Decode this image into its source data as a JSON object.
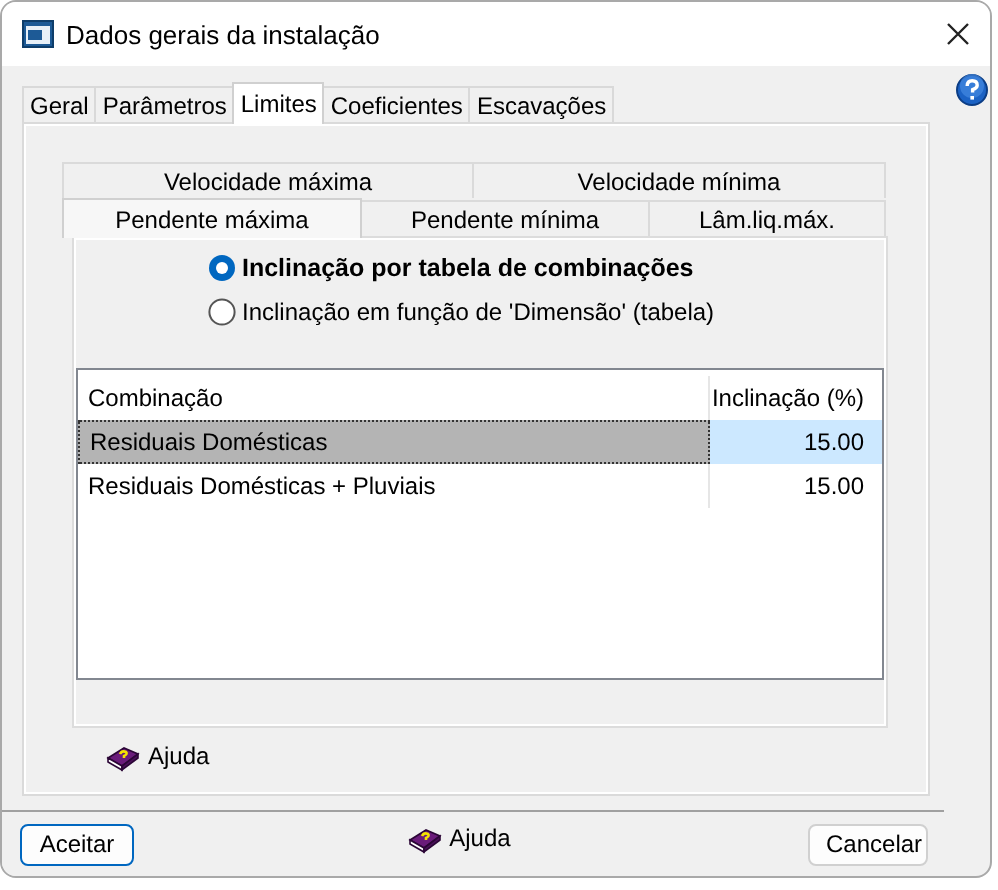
{
  "window": {
    "title": "Dados gerais da instalação"
  },
  "tabs": [
    {
      "label": "Geral",
      "selected": false
    },
    {
      "label": "Parâmetros",
      "selected": false
    },
    {
      "label": "Limites",
      "selected": true
    },
    {
      "label": "Coeficientes",
      "selected": false
    },
    {
      "label": "Escavações",
      "selected": false
    }
  ],
  "subtab_rows": [
    {
      "tabs": [
        {
          "label": "Velocidade máxima",
          "selected": false
        },
        {
          "label": "Velocidade mínima",
          "selected": false
        }
      ]
    },
    {
      "tabs": [
        {
          "label": "Pendente máxima",
          "selected": true
        },
        {
          "label": "Pendente mínima",
          "selected": false
        },
        {
          "label": "Lâm.liq.máx.",
          "selected": false
        }
      ]
    }
  ],
  "options": [
    {
      "label": "Inclinação por tabela de combinações",
      "selected": true
    },
    {
      "label": "Inclinação em função de 'Dimensão' (tabela)",
      "selected": false
    }
  ],
  "table": {
    "columns": [
      "Combinação",
      "Inclinação (%)"
    ],
    "rows": [
      {
        "cells": [
          "Residuais Domésticas",
          "15.00"
        ],
        "selected": true
      },
      {
        "cells": [
          "Residuais Domésticas + Pluviais",
          "15.00"
        ],
        "selected": false
      }
    ]
  },
  "help_link": "Ajuda",
  "footer": {
    "accept": "Aceitar",
    "help": "Ajuda",
    "cancel": "Cancelar"
  }
}
